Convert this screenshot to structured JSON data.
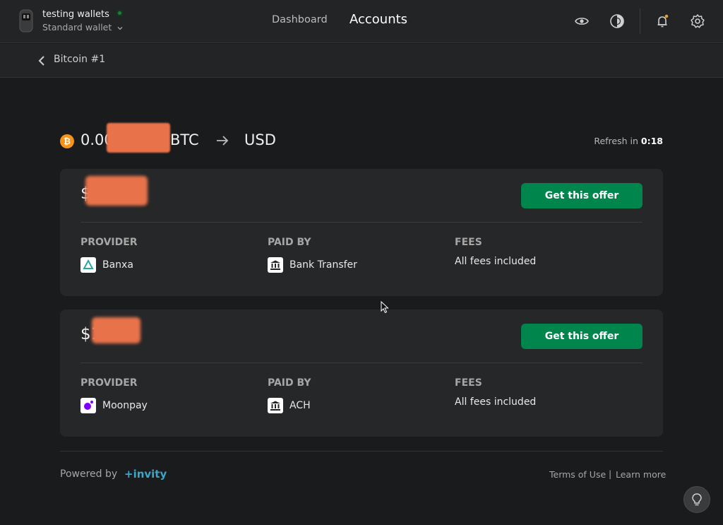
{
  "header": {
    "wallet_name": "testing wallets",
    "wallet_type": "Standard wallet",
    "nav": {
      "dashboard": "Dashboard",
      "accounts": "Accounts"
    },
    "icons": [
      "device-icon",
      "eye-icon",
      "theme-icon",
      "bell-icon",
      "gear-icon"
    ],
    "status_color": "#1e7d3a"
  },
  "breadcrumb": {
    "label": "Bitcoin #1"
  },
  "summary": {
    "amount_prefix": "0.00",
    "crypto": "BTC",
    "fiat": "USD",
    "refresh_label": "Refresh in",
    "refresh_time": "0:18"
  },
  "offers": [
    {
      "price_prefix": "$",
      "button_label": "Get this offer",
      "provider_title": "PROVIDER",
      "provider": "Banxa",
      "paid_by_title": "PAID BY",
      "paid_by": "Bank Transfer",
      "fees_title": "FEES",
      "fees": "All fees included"
    },
    {
      "price_prefix": "$1",
      "button_label": "Get this offer",
      "provider_title": "PROVIDER",
      "provider": "Moonpay",
      "paid_by_title": "PAID BY",
      "paid_by": "ACH",
      "fees_title": "FEES",
      "fees": "All fees included"
    }
  ],
  "footer": {
    "powered_by": "Powered by",
    "brand": "+invity",
    "terms": "Terms of Use",
    "separator": "|",
    "learn_more": "Learn more"
  },
  "colors": {
    "accent": "#00854d",
    "brand": "#3ea5c8",
    "bitcoin": "#f7931a"
  }
}
